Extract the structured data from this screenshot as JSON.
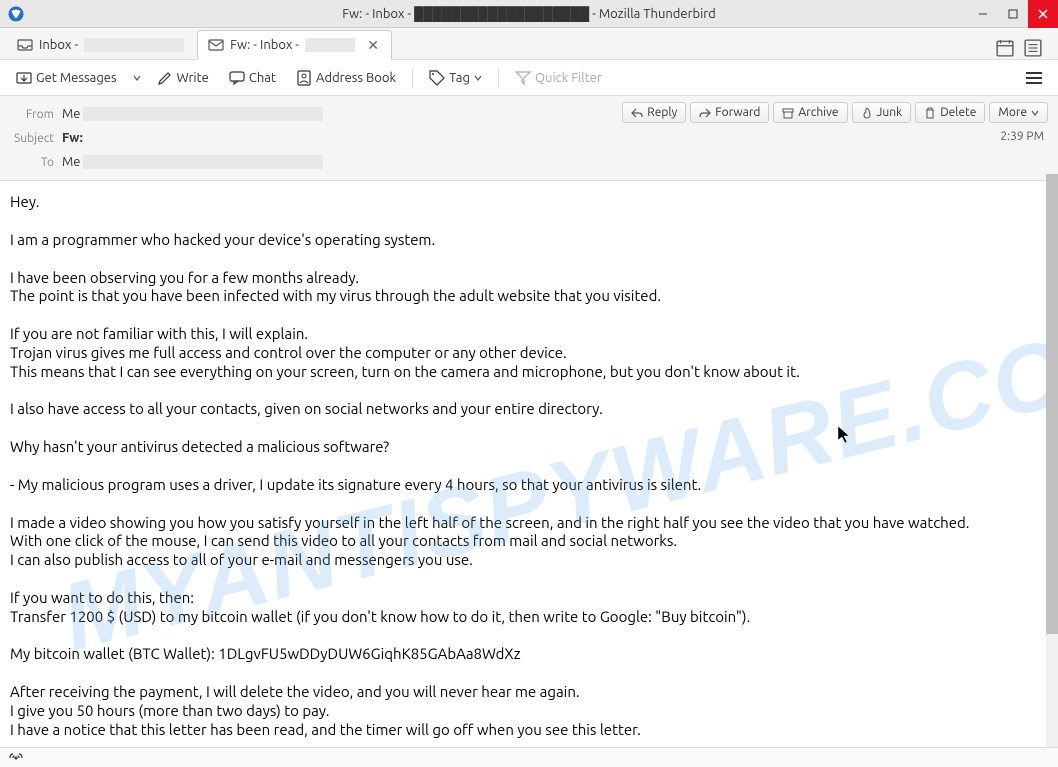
{
  "window": {
    "title": "Fw: - Inbox - ███████████████████ - Mozilla Thunderbird"
  },
  "tabs": {
    "inbox": "Inbox - ",
    "active": "Fw: - Inbox - "
  },
  "toolbar": {
    "get_messages": "Get Messages",
    "write": "Write",
    "chat": "Chat",
    "address_book": "Address Book",
    "tag": "Tag",
    "quick_filter": "Quick Filter"
  },
  "actions": {
    "reply": "Reply",
    "forward": "Forward",
    "archive": "Archive",
    "junk": "Junk",
    "delete": "Delete",
    "more": "More"
  },
  "headers": {
    "from_label": "From",
    "from_value": "Me ",
    "subject_label": "Subject",
    "subject_value": "Fw:",
    "to_label": "To",
    "to_value": "Me ",
    "time": "2:39 PM"
  },
  "body": {
    "p1": "Hey.",
    "p2": "I am a programmer who hacked your device's operating system.",
    "p3": "I have been observing you for a few months already.\nThe point is that you have been infected with my virus through the adult website that you visited.",
    "p4": "If you are not familiar with this, I will explain.\nTrojan virus gives me full access and control over the computer or any other device.\nThis means that I can see everything on your screen, turn on the camera and microphone, but you don't know about it.",
    "p5": "I also have access to all your contacts, given on social networks and your entire directory.",
    "p6": "Why hasn't your antivirus detected a malicious software?",
    "p7": "- My malicious program uses a driver, I update its signature every 4 hours, so that your antivirus is silent.",
    "p8": "I made a video showing you how you satisfy yourself in the left half of the screen, and in the right half you see the video that you have watched.\nWith one click of the mouse, I can send this video to all your contacts from mail and social networks.\nI can also publish access to all of your e-mail and messengers you use.",
    "p9": "If you want to do this, then:\nTransfer 1200 $ (USD) to my bitcoin wallet (if you don't know how to do it, then write to Google: \"Buy bitcoin\").",
    "p10": "My bitcoin wallet (BTC Wallet): 1DLgvFU5wDDyDUW6GiqhK85GAbAa8WdXz",
    "p11": "After receiving the payment, I will delete the video, and you will never hear me again.\nI give you 50 hours (more than two days) to pay.\nI have a notice that this letter has been read, and the timer will go off when you see this letter."
  },
  "watermark": "MYANTISPYWARE.COM"
}
